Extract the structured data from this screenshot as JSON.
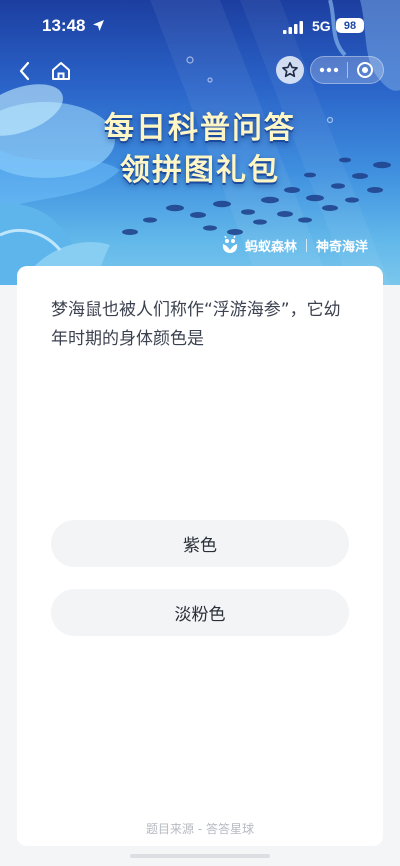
{
  "status_bar": {
    "time": "13:48",
    "network": "5G",
    "battery": "98",
    "location_icon": "location-arrow-icon",
    "signal_icon": "signal-icon"
  },
  "nav": {
    "back_icon": "chevron-left-icon",
    "home_icon": "home-icon",
    "favorite_icon": "star-icon",
    "more_icon": "more-icon",
    "close_icon": "target-icon"
  },
  "banner": {
    "title_line1": "每日科普问答",
    "title_line2": "领拼图礼包",
    "brand_name": "蚂蚁森林",
    "partner_name": "神奇海洋",
    "brand_icon": "ant-forest-logo-icon"
  },
  "quiz": {
    "question": "梦海鼠也被人们称作“浮游海参”，它幼年时期的身体颜色是",
    "options": [
      {
        "label": "紫色"
      },
      {
        "label": "淡粉色"
      }
    ]
  },
  "footer": {
    "source": "题目来源 - 答答星球"
  },
  "colors": {
    "banner_top": "#1c3ea0",
    "banner_bottom": "#7ac6ec",
    "title_text": "#fff6c6",
    "option_bg": "#f3f4f6",
    "page_bg": "#f4f5f7"
  }
}
